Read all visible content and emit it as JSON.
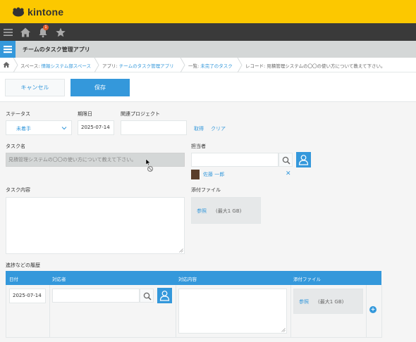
{
  "header": {
    "logo_text": "kintone",
    "brand_color": "#fcc800"
  },
  "iconbar": {
    "notification_count": "1",
    "icons": [
      "menu-icon",
      "home-icon",
      "bell-icon",
      "star-icon"
    ]
  },
  "app": {
    "title": "チームのタスク管理アプリ"
  },
  "breadcrumb": {
    "space_prefix": "スペース: ",
    "space_name": "情報システム部スペース",
    "app_prefix": "アプリ: ",
    "app_name": "チームのタスク管理アプリ",
    "view_prefix": "一覧: ",
    "view_name": "未完了のタスク",
    "record": "レコード: 見積管理システムの〇〇の使い方について教えて下さい。"
  },
  "actions": {
    "cancel_label": "キャンセル",
    "save_label": "保存"
  },
  "form": {
    "status_label": "ステータス",
    "status_value": "未着手",
    "due_label": "期限日",
    "due_value": "2025-07-14",
    "project_label": "関連プロジェクト",
    "project_value": "",
    "fetch_label": "取得",
    "clear_label": "クリア",
    "taskname_label": "タスク名",
    "taskname_value": "見積管理システムの〇〇の使い方について教えて下さい。",
    "assignee_label": "担当者",
    "assignee_name": "佐藤 一郎",
    "remove_glyph": "✕",
    "content_label": "タスク内容",
    "attachment_label": "添付ファイル",
    "browse_label": "参照",
    "max_size_note": "(最大1 GB)"
  },
  "history": {
    "title": "進捗などの履歴",
    "columns": [
      "日付",
      "対応者",
      "対応内容",
      "添付ファイル"
    ],
    "row": {
      "date": "2025-07-14",
      "browse_label": "参照",
      "max_size_note": "(最大1 GB)"
    },
    "add_glyph": "+"
  }
}
